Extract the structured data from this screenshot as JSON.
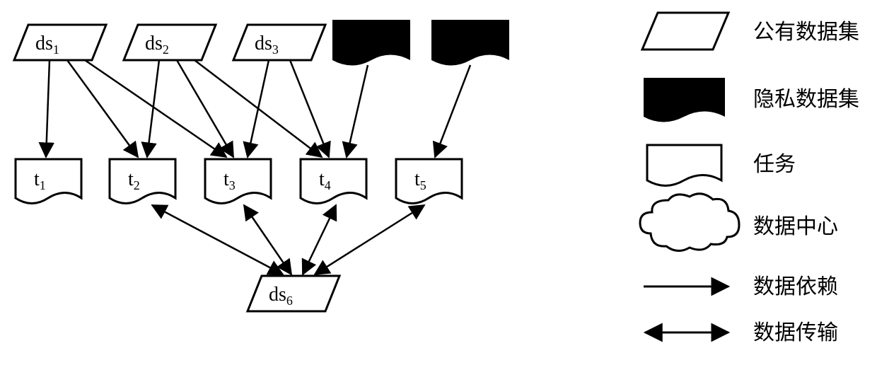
{
  "nodes": {
    "ds1": {
      "label": "ds",
      "sub": "1"
    },
    "ds2": {
      "label": "ds",
      "sub": "2"
    },
    "ds3": {
      "label": "ds",
      "sub": "3"
    },
    "ds6": {
      "label": "ds",
      "sub": "6"
    },
    "t1": {
      "label": "t",
      "sub": "1"
    },
    "t2": {
      "label": "t",
      "sub": "2"
    },
    "t3": {
      "label": "t",
      "sub": "3"
    },
    "t4": {
      "label": "t",
      "sub": "4"
    },
    "t5": {
      "label": "t",
      "sub": "5"
    }
  },
  "legend": {
    "public_dataset": "公有数据集",
    "private_dataset": "隐私数据集",
    "task": "任务",
    "datacenter": "数据中心",
    "data_dependency": "数据依赖",
    "data_transfer": "数据传输"
  },
  "chart_data": {
    "type": "diagram",
    "title": "",
    "nodes": [
      {
        "id": "ds1",
        "type": "public_dataset",
        "label": "ds1"
      },
      {
        "id": "ds2",
        "type": "public_dataset",
        "label": "ds2"
      },
      {
        "id": "ds3",
        "type": "public_dataset",
        "label": "ds3"
      },
      {
        "id": "pds4",
        "type": "private_dataset",
        "label": ""
      },
      {
        "id": "pds5",
        "type": "private_dataset",
        "label": ""
      },
      {
        "id": "t1",
        "type": "task",
        "label": "t1"
      },
      {
        "id": "t2",
        "type": "task",
        "label": "t2"
      },
      {
        "id": "t3",
        "type": "task",
        "label": "t3"
      },
      {
        "id": "t4",
        "type": "task",
        "label": "t4"
      },
      {
        "id": "t5",
        "type": "task",
        "label": "t5"
      },
      {
        "id": "ds6",
        "type": "public_dataset",
        "label": "ds6"
      }
    ],
    "edges": [
      {
        "from": "ds1",
        "to": "t1",
        "type": "dependency"
      },
      {
        "from": "ds1",
        "to": "t2",
        "type": "dependency"
      },
      {
        "from": "ds1",
        "to": "t3",
        "type": "dependency"
      },
      {
        "from": "ds2",
        "to": "t2",
        "type": "dependency"
      },
      {
        "from": "ds2",
        "to": "t3",
        "type": "dependency"
      },
      {
        "from": "ds2",
        "to": "t4",
        "type": "dependency"
      },
      {
        "from": "ds3",
        "to": "t3",
        "type": "dependency"
      },
      {
        "from": "ds3",
        "to": "t4",
        "type": "dependency"
      },
      {
        "from": "pds4",
        "to": "t4",
        "type": "dependency"
      },
      {
        "from": "pds5",
        "to": "t5",
        "type": "dependency"
      },
      {
        "from": "t2",
        "to": "ds6",
        "type": "transfer"
      },
      {
        "from": "t3",
        "to": "ds6",
        "type": "transfer"
      },
      {
        "from": "t4",
        "to": "ds6",
        "type": "transfer"
      },
      {
        "from": "t5",
        "to": "ds6",
        "type": "transfer"
      }
    ],
    "legend": {
      "public_dataset": "公有数据集",
      "private_dataset": "隐私数据集",
      "task": "任务",
      "datacenter": "数据中心",
      "data_dependency": "数据依赖",
      "data_transfer": "数据传输"
    }
  }
}
